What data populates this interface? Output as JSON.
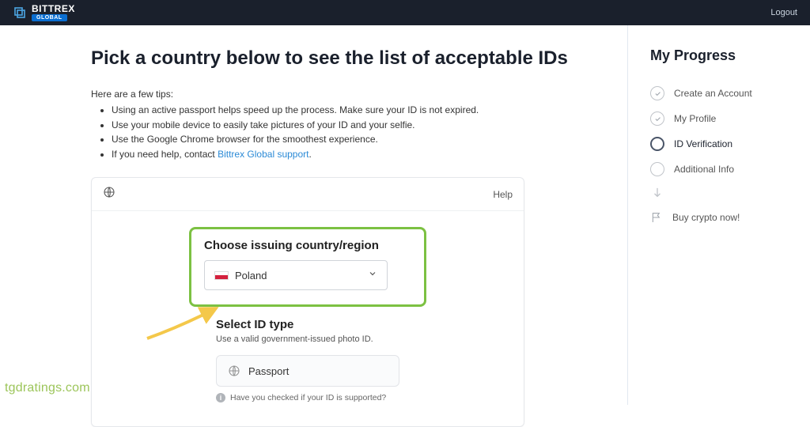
{
  "header": {
    "brand": "BITTREX",
    "brand_sub": "GLOBAL",
    "logout": "Logout"
  },
  "main": {
    "title": "Pick a country below to see the list of acceptable IDs",
    "tips_lead": "Here are a few tips:",
    "tips": [
      "Using an active passport helps speed up the process. Make sure your ID is not expired.",
      "Use your mobile device to easily take pictures of your ID and your selfie.",
      "Use the Google Chrome browser for the smoothest experience."
    ],
    "tips_help_prefix": "If you need help, contact ",
    "tips_help_link": "Bittrex Global support",
    "card": {
      "help": "Help",
      "choose_title": "Choose issuing country/region",
      "country": "Poland",
      "select_title": "Select ID type",
      "select_sub": "Use a valid government-issued photo ID.",
      "option_passport": "Passport",
      "support_question": "Have you checked if your ID is supported?"
    }
  },
  "side": {
    "title": "My Progress",
    "steps": {
      "s1": "Create an Account",
      "s2": "My Profile",
      "s3": "ID Verification",
      "s4": "Additional Info",
      "s5": "Buy crypto now!"
    }
  },
  "watermark": "tgdratings.com"
}
